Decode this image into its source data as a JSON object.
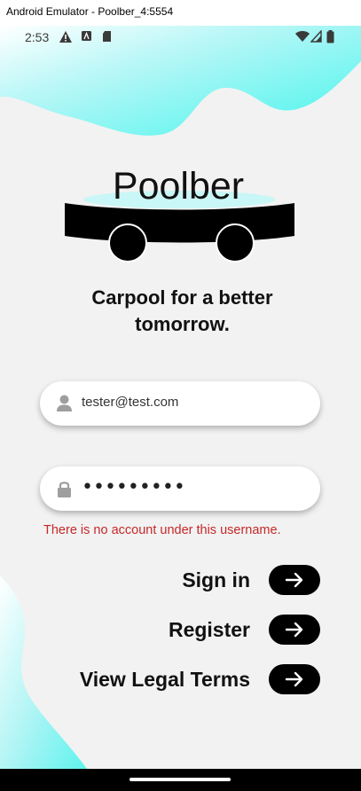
{
  "window": {
    "title": "Android Emulator - Poolber_4:5554"
  },
  "status_bar": {
    "time": "2:53",
    "left_icons": [
      "warning-icon",
      "app-badge-icon",
      "sd-card-icon"
    ],
    "right_icons": [
      "wifi-icon",
      "signal-icon",
      "battery-icon"
    ]
  },
  "logo": {
    "text": "Poolber"
  },
  "tagline": {
    "line1": "Carpool for a better",
    "line2": "tomorrow."
  },
  "form": {
    "email": {
      "value": "tester@test.com",
      "icon": "person-icon"
    },
    "password": {
      "masked_value": "•••••••••",
      "icon": "lock-icon"
    },
    "error": "There is no account under this username."
  },
  "actions": {
    "sign_in": "Sign in",
    "register": "Register",
    "legal": "View Legal Terms"
  },
  "colors": {
    "accent": "#5ff5ee",
    "error": "#c62828",
    "button": "#000000",
    "background": "#f2f2f2"
  }
}
